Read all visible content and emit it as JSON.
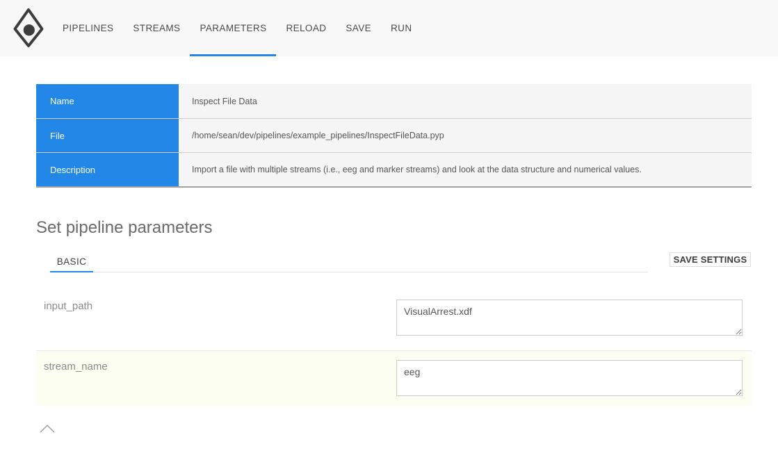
{
  "nav": {
    "items": [
      {
        "label": "PIPELINES",
        "active": false
      },
      {
        "label": "STREAMS",
        "active": false
      },
      {
        "label": "PARAMETERS",
        "active": true
      },
      {
        "label": "RELOAD",
        "active": false
      },
      {
        "label": "SAVE",
        "active": false
      },
      {
        "label": "RUN",
        "active": false
      }
    ]
  },
  "icons": {
    "logo": "app-logo-diamond-dot",
    "collapse": "chevron-up"
  },
  "info_table": {
    "rows": [
      {
        "label": "Name",
        "value": "Inspect File Data"
      },
      {
        "label": "File",
        "value": "/home/sean/dev/pipelines/example_pipelines/InspectFileData.pyp"
      },
      {
        "label": "Description",
        "value": "Import a file with multiple streams (i.e., eeg and marker streams) and look at the data structure and numerical values."
      }
    ]
  },
  "parameters": {
    "heading": "Set pipeline parameters",
    "tab_label": "BASIC",
    "save_button_label": "SAVE SETTINGS",
    "fields": [
      {
        "name": "input_path",
        "value": "VisualArrest.xdf"
      },
      {
        "name": "stream_name",
        "value": "eeg"
      }
    ]
  },
  "colors": {
    "accent_blue": "#2287e6",
    "nav_background": "#f8f8f8",
    "table_label_background": "#2287e6",
    "table_value_background": "#f5f5f5",
    "highlight_row_background": "#fdfef2",
    "table_bottom_border": "#a1a1a1"
  }
}
